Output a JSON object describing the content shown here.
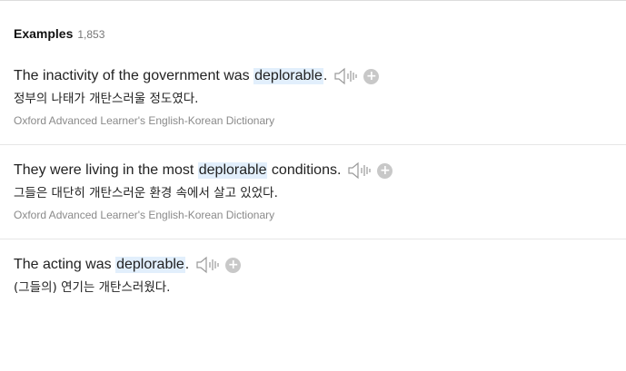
{
  "examples_section": {
    "title": "Examples",
    "count": "1,853"
  },
  "examples": [
    {
      "en_before": "The inactivity of the government was ",
      "en_highlight": "deplorable",
      "en_after": ".",
      "ko": "정부의 나태가 개탄스러울 정도였다.",
      "source": "Oxford Advanced Learner's English-Korean Dictionary"
    },
    {
      "en_before": "They were living in the most ",
      "en_highlight": "deplorable",
      "en_after": " conditions.",
      "ko": "그들은 대단히 개탄스러운 환경 속에서 살고 있었다.",
      "source": "Oxford Advanced Learner's English-Korean Dictionary"
    },
    {
      "en_before": "The acting was ",
      "en_highlight": "deplorable",
      "en_after": ".",
      "ko": "(그들의) 연기는 개탄스러웠다."
    }
  ],
  "icons": {
    "speaker": "speaker-icon",
    "add": "add-icon",
    "add_glyph": "+"
  },
  "colors": {
    "highlight": "#e2effc",
    "icon_gray": "#c8c8c8",
    "source_text": "#8a8a8a"
  }
}
